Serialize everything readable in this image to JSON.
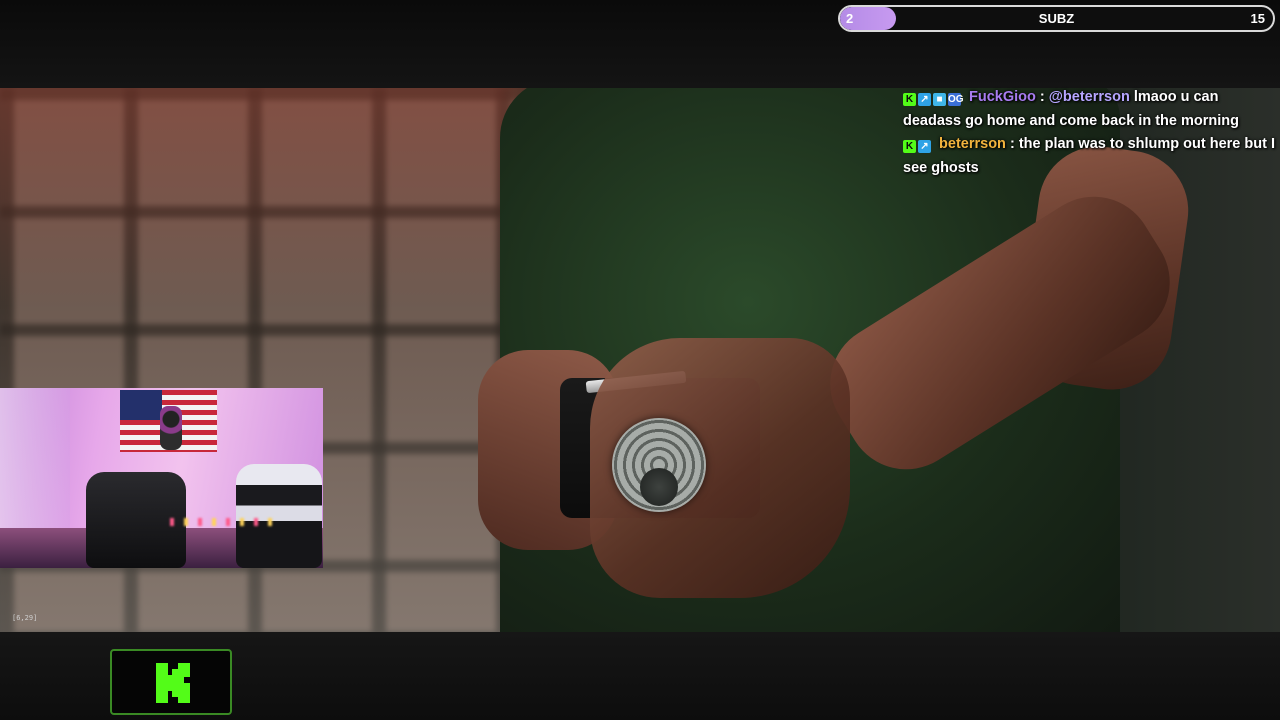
{
  "sub_goal": {
    "current": "2",
    "label": "SUBZ",
    "target": "15",
    "progress_fraction": 0.13,
    "fill_color": "#b48be6"
  },
  "chat": {
    "messages": [
      {
        "badges": [
          "kick-badge",
          "arrow-badge",
          "cube-badge",
          "og-badge"
        ],
        "username": "FuckGioo",
        "username_color": "#a87cf0",
        "mention": "@beterrson",
        "text": " lmaoo u can deadass go home and come back in the morning"
      },
      {
        "badges": [
          "kick-badge",
          "arrow-badge"
        ],
        "username": "beterrson",
        "username_color": "#f2b33d",
        "mention": "",
        "text": "the plan was to shlump out here but I see ghosts"
      }
    ]
  },
  "overlay": {
    "coord_readout": "[6,29]"
  },
  "brand": {
    "logo": "kick-logo",
    "accent": "#53fc18"
  }
}
